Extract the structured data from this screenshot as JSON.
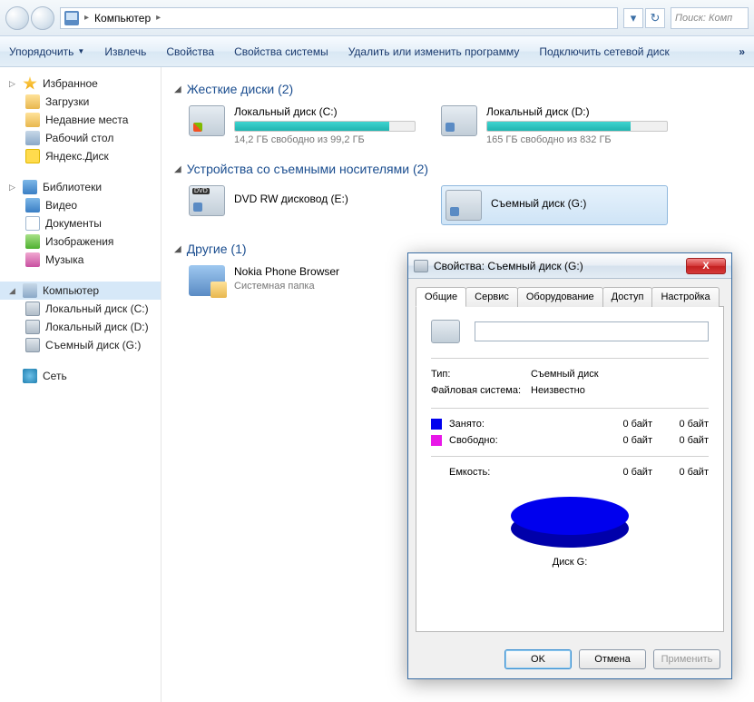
{
  "breadcrumb": {
    "root_glyph": "▸",
    "location": "Компьютер",
    "arrow": "▸"
  },
  "nav": {
    "refresh_glyph": "↻",
    "dropdown_glyph": "▾"
  },
  "search": {
    "placeholder": "Поиск: Комп"
  },
  "toolbar": {
    "organize": "Упорядочить",
    "extract": "Извлечь",
    "properties": "Свойства",
    "sys_properties": "Свойства системы",
    "uninstall": "Удалить или изменить программу",
    "map_drive": "Подключить сетевой диск",
    "overflow": "»"
  },
  "sidebar": {
    "favorites": "Избранное",
    "downloads": "Загрузки",
    "recent": "Недавние места",
    "desktop": "Рабочий стол",
    "yandex": "Яндекс.Диск",
    "libraries": "Библиотеки",
    "video": "Видео",
    "documents": "Документы",
    "images": "Изображения",
    "music": "Музыка",
    "computer": "Компьютер",
    "drive_c": "Локальный диск (C:)",
    "drive_d": "Локальный диск (D:)",
    "drive_g": "Съемный диск (G:)",
    "network": "Сеть"
  },
  "sections": {
    "hard_drives": "Жесткие диски (2)",
    "removable": "Устройства со съемными носителями (2)",
    "other": "Другие (1)"
  },
  "drives": {
    "c": {
      "name": "Локальный диск (C:)",
      "sub": "14,2 ГБ свободно из 99,2 ГБ",
      "fill_pct": 86
    },
    "d": {
      "name": "Локальный диск (D:)",
      "sub": "165 ГБ свободно из 832 ГБ",
      "fill_pct": 80
    },
    "dvd": {
      "name": "DVD RW дисковод (E:)"
    },
    "g": {
      "name": "Съемный диск (G:)"
    },
    "nokia": {
      "name": "Nokia Phone Browser",
      "sub": "Системная папка"
    }
  },
  "dialog": {
    "title": "Свойства: Съемный диск (G:)",
    "close_glyph": "X",
    "tabs": {
      "general": "Общие",
      "service": "Сервис",
      "hardware": "Оборудование",
      "access": "Доступ",
      "settings": "Настройка"
    },
    "name_value": "",
    "type_label": "Тип:",
    "type_value": "Съемный диск",
    "fs_label": "Файловая система:",
    "fs_value": "Неизвестно",
    "used_label": "Занято:",
    "used_v1": "0 байт",
    "used_v2": "0 байт",
    "free_label": "Свободно:",
    "free_v1": "0 байт",
    "free_v2": "0 байт",
    "capacity_label": "Емкость:",
    "capacity_v1": "0 байт",
    "capacity_v2": "0 байт",
    "pie_label": "Диск G:",
    "ok": "OK",
    "cancel": "Отмена",
    "apply": "Применить"
  }
}
